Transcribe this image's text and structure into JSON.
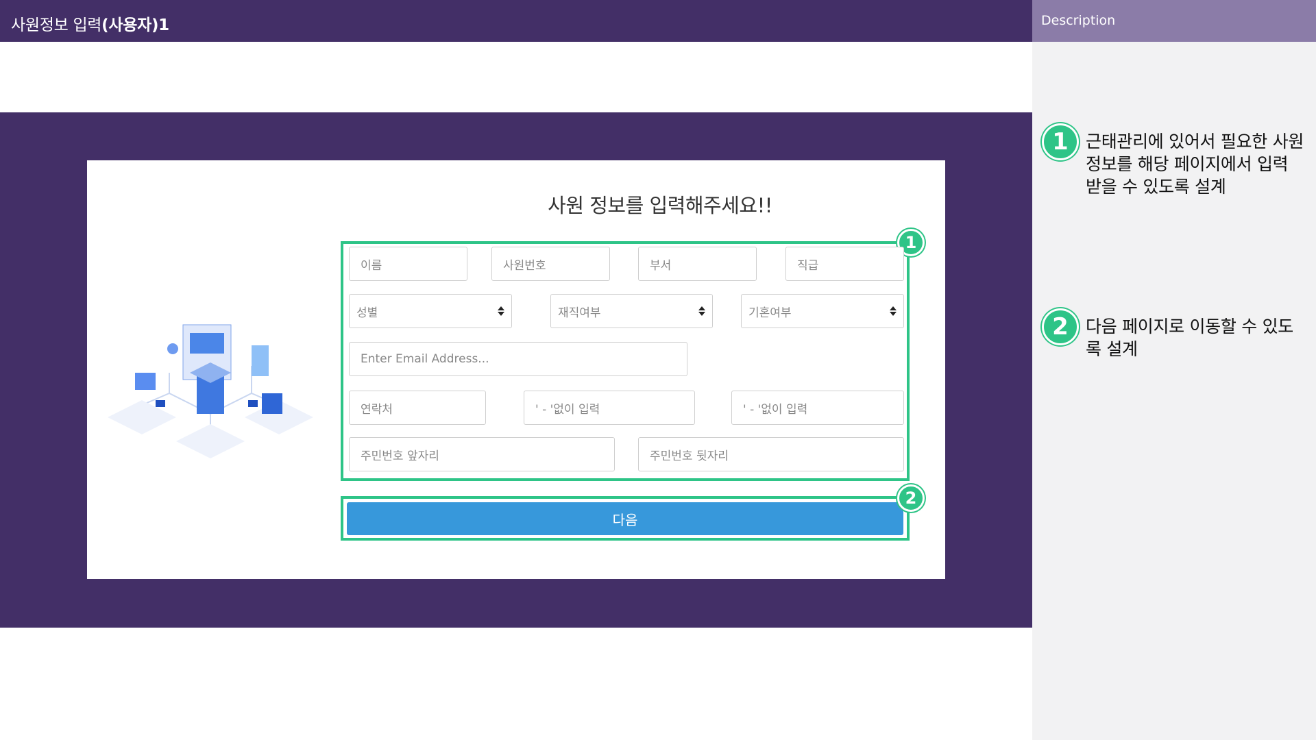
{
  "header": {
    "title_prefix": "사원정보 입력",
    "title_suffix": "(사용자)1"
  },
  "description": {
    "heading": "Description",
    "items": [
      {
        "num": "1",
        "text": "근태관리에 있어서 필요한 사원정보를 해당 페이지에서 입력 받을 수 있도록 설계"
      },
      {
        "num": "2",
        "text": "다음 페이지로 이동할 수 있도록 설계"
      }
    ]
  },
  "form": {
    "heading": "사원 정보를 입력해주세요!!",
    "badges": [
      "1",
      "2"
    ],
    "name_placeholder": "이름",
    "emp_no_placeholder": "사원번호",
    "dept_placeholder": "부서",
    "rank_placeholder": "직급",
    "gender_select": "성별",
    "employment_select": "재직여부",
    "marital_select": "기혼여부",
    "email_placeholder": "Enter Email Address...",
    "phone_placeholder": "연락처",
    "phone_mid_placeholder": "' - '없이 입력",
    "phone_last_placeholder": "' - '없이 입력",
    "rrn_front_placeholder": "주민번호 앞자리",
    "rrn_back_placeholder": "주민번호 뒷자리",
    "next_label": "다음"
  },
  "colors": {
    "brand": "#432f67",
    "accent": "#2ec487",
    "button": "#3798db",
    "sidebar_head": "#8b7ca8"
  }
}
